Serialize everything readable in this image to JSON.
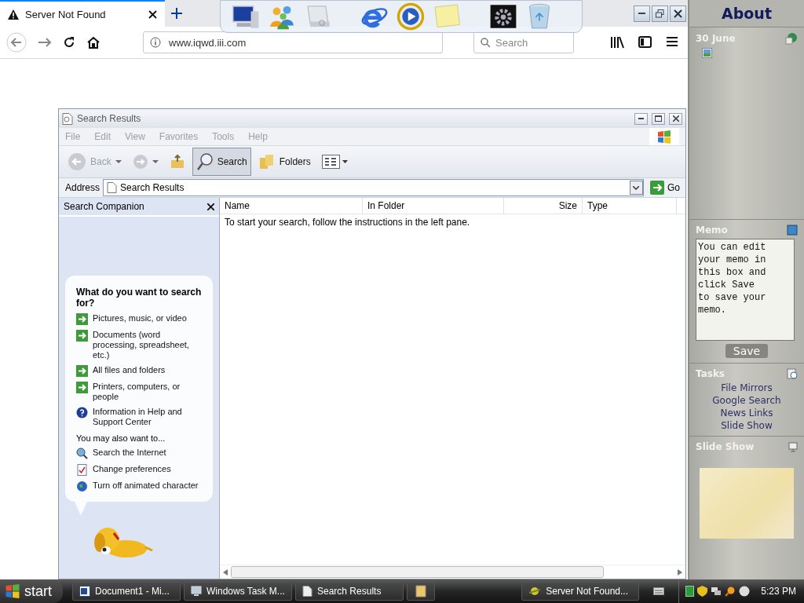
{
  "browser": {
    "tabs": [
      {
        "title": "Server Not Found",
        "selected": true
      }
    ],
    "url": "www.iqwd.iii.com",
    "search_placeholder": "Search"
  },
  "sidebar": {
    "title": "About",
    "date": "30 June",
    "memo": {
      "title": "Memo",
      "text": "You can edit your memo in this box and click Save to save your memo.",
      "save": "Save"
    },
    "tasks": {
      "title": "Tasks",
      "links": [
        "File Mirrors",
        "Google Search",
        "News Links",
        "Slide Show"
      ]
    },
    "slideshow": {
      "title": "Slide Show"
    }
  },
  "explorer": {
    "title": "Search Results",
    "menu": [
      "File",
      "Edit",
      "View",
      "Favorites",
      "Tools",
      "Help"
    ],
    "toolbar": [
      {
        "kind": "back",
        "label": "Back",
        "selected": false
      },
      {
        "kind": "forward",
        "selected": false
      },
      {
        "kind": "up",
        "selected": false
      },
      {
        "kind": "search",
        "label": "Search",
        "selected": true
      },
      {
        "kind": "folders",
        "label": "Folders",
        "selected": false
      },
      {
        "kind": "views",
        "selected": false
      }
    ],
    "address_label": "Address",
    "address": "Search Results",
    "go": "Go",
    "companion": {
      "title": "Search Companion",
      "question": "What do you want to search for?",
      "options": [
        {
          "kind": "arrow",
          "label": "Pictures, music, or video"
        },
        {
          "kind": "arrow",
          "label": "Documents (word processing, spreadsheet, etc.)"
        },
        {
          "kind": "arrow",
          "label": "All files and folders"
        },
        {
          "kind": "arrow",
          "label": "Printers, computers, or people"
        },
        {
          "kind": "help",
          "label": "Information in Help and Support Center"
        }
      ],
      "more_heading": "You may also want to...",
      "more": [
        {
          "kind": "web",
          "label": "Search the Internet"
        },
        {
          "kind": "prefs",
          "label": "Change preferences"
        },
        {
          "kind": "character",
          "label": "Turn off animated character"
        }
      ]
    },
    "columns": [
      "Name",
      "In Folder",
      "Size",
      "Type"
    ],
    "empty_message": "To start your search, follow the instructions in the left pane."
  },
  "taskbar": {
    "start": "start",
    "buttons": [
      {
        "kind": "word",
        "label": "Document1 - Mi...",
        "selected": false
      },
      {
        "kind": "monitor",
        "label": "Windows Task M...",
        "selected": false
      },
      {
        "kind": "page",
        "label": "Search Results",
        "selected": false
      },
      {
        "kind": "folder",
        "selected": false
      }
    ],
    "browser_button": {
      "label": "Server Not Found...",
      "selected": false
    },
    "clock": "5:23 PM"
  }
}
